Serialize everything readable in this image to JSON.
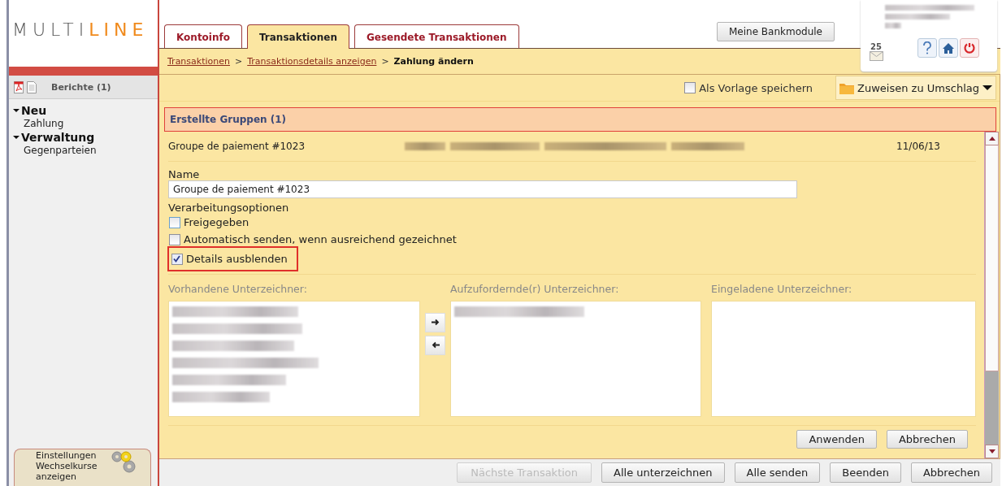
{
  "logo": {
    "light": "MULTI",
    "accent": "LINE"
  },
  "sidebar": {
    "reports": "Berichte (1)",
    "sections": [
      {
        "label": "Neu",
        "expanded": true,
        "children": [
          {
            "label": "Zahlung"
          }
        ]
      },
      {
        "label": "Verwaltung",
        "expanded": true,
        "children": [
          {
            "label": "Gegenparteien"
          }
        ]
      }
    ],
    "settings": [
      "Einstellungen",
      "Wechselkurse anzeigen"
    ]
  },
  "tabs": [
    {
      "label": "Kontoinfo",
      "selected": false
    },
    {
      "label": "Transaktionen",
      "selected": true
    },
    {
      "label": "Gesendete Transaktionen",
      "selected": false
    }
  ],
  "header_button": "Meine Bankmodule",
  "user_panel": {
    "mail_count": "25"
  },
  "breadcrumb": [
    {
      "label": "Transaktionen",
      "link": true
    },
    {
      "label": ">",
      "kind": "separator"
    },
    {
      "label": "Transaktionsdetails anzeigen",
      "link": true
    },
    {
      "label": ">",
      "kind": "separator"
    },
    {
      "label": "Zahlung ändern",
      "link": false
    }
  ],
  "toolbar": {
    "template_checkbox": {
      "label": "Als Vorlage speichern",
      "checked": false
    },
    "envelope_menu": "Zuweisen zu Umschlag"
  },
  "group": {
    "title": "Erstellte Gruppen (1)",
    "name": "Groupe de paiement #1023",
    "date": "11/06/13",
    "name_label": "Name",
    "name_value": "Groupe de paiement #1023",
    "options_label": "Verarbeitungsoptionen",
    "options": [
      {
        "label": "Freigegeben",
        "checked": false,
        "highlighted": false
      },
      {
        "label": "Automatisch senden, wenn ausreichend gezeichnet",
        "checked": false,
        "highlighted": false
      },
      {
        "label": "Details ausblenden",
        "checked": true,
        "highlighted": true
      }
    ],
    "signer_lists": [
      {
        "title": "Vorhandene Unterzeichner:"
      },
      {
        "title": "Aufzufordernde(r) Unterzeichner:"
      },
      {
        "title": "Eingeladene Unterzeichner:"
      }
    ],
    "buttons": [
      "Anwenden",
      "Abbrechen"
    ]
  },
  "footer_buttons": [
    {
      "label": "Nächste Transaktion",
      "disabled": true
    },
    {
      "label": "Alle unterzeichnen",
      "disabled": false
    },
    {
      "label": "Alle senden",
      "disabled": false
    },
    {
      "label": "Beenden",
      "disabled": false
    },
    {
      "label": "Abbrechen",
      "disabled": false
    }
  ]
}
